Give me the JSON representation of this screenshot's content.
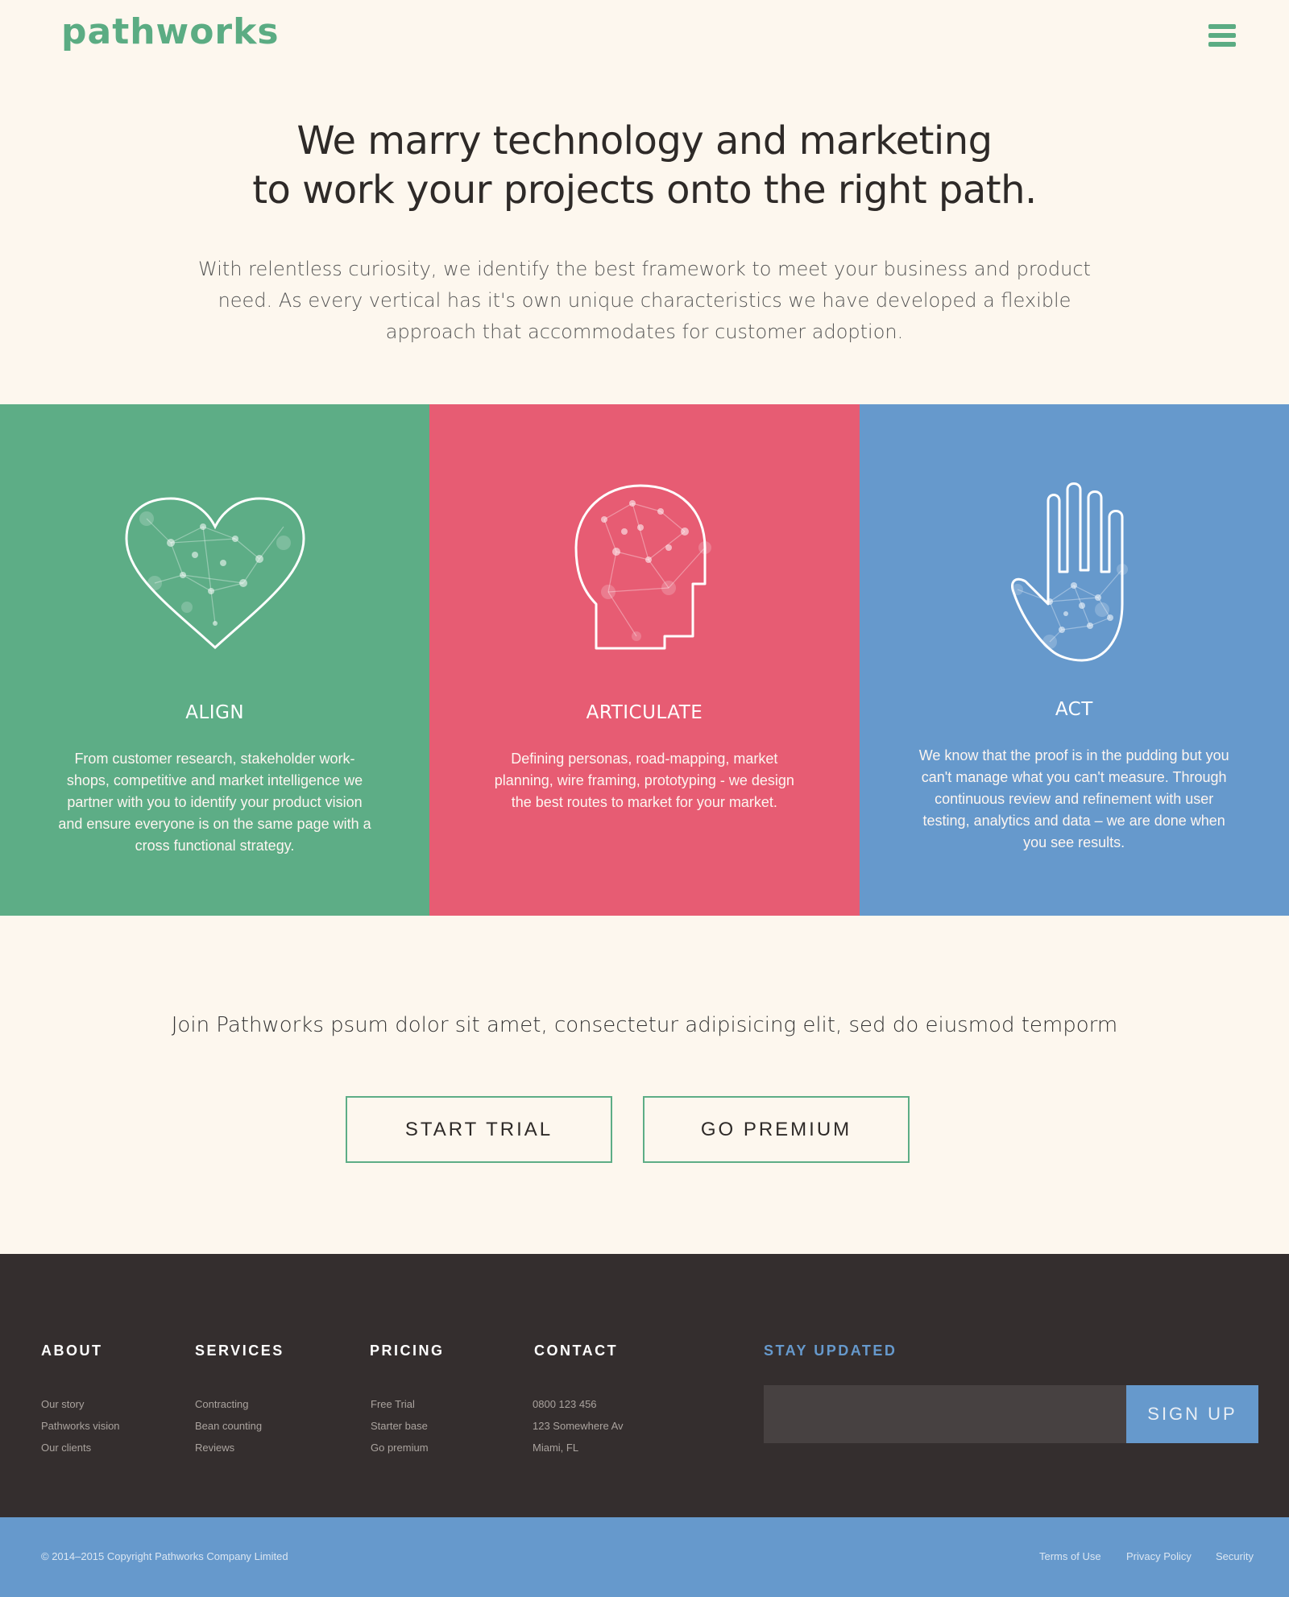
{
  "header": {
    "logo": "pathworks",
    "menu_icon": "hamburger-menu-icon"
  },
  "hero": {
    "title_line1": "We marry technology and marketing",
    "title_line2": "to work your projects onto the right path.",
    "subtitle": "With relentless curiosity, we identify the best framework to meet your business  and product need. As every vertical has it's own unique characteristics we have developed a flexible approach that accommodates for customer adoption."
  },
  "columns": [
    {
      "title": "ALIGN",
      "icon": "heart-network-icon",
      "color": "#5dad86",
      "text": "From customer research, stakeholder work-shops, competitive and market intelligence we partner with you to identify your product vision and ensure everyone is on the same page with a cross functional strategy."
    },
    {
      "title": "ARTICULATE",
      "icon": "head-network-icon",
      "color": "#e75c73",
      "text": "Defining personas, road-mapping, market planning, wire framing, prototyping - we design the best routes to market for your market."
    },
    {
      "title": "ACT",
      "icon": "hand-network-icon",
      "color": "#6699cc",
      "text": "We know that the proof is in the pudding but you can't manage what you can't measure.  Through continuous review and refinement with user testing, analytics and data – we are done when you see results."
    }
  ],
  "cta": {
    "text": "Join Pathworks psum dolor sit amet, consectetur adipisicing elit, sed do eiusmod temporm",
    "start_trial": "START TRIAL",
    "go_premium": "GO PREMIUM"
  },
  "footer": {
    "about": {
      "heading": "ABOUT",
      "links": [
        "Our story",
        "Pathworks vision",
        "Our clients"
      ]
    },
    "services": {
      "heading": "SERVICES",
      "links": [
        "Contracting",
        "Bean counting",
        "Reviews"
      ]
    },
    "pricing": {
      "heading": "PRICING",
      "links": [
        "Free Trial",
        "Starter base",
        "Go premium"
      ]
    },
    "contact": {
      "heading": "CONTACT",
      "lines": [
        "0800 123 456",
        "123 Somewhere Av",
        "Miami, FL"
      ]
    },
    "newsletter": {
      "heading": "STAY UPDATED",
      "input_value": "",
      "button": "SIGN UP"
    }
  },
  "bottom_bar": {
    "copyright": "© 2014–2015 Copyright Pathworks Company Limited",
    "terms": "Terms of Use",
    "privacy": "Privacy Policy",
    "security": "Security"
  },
  "colors": {
    "background": "#fdf7ee",
    "brand_green": "#5dad86",
    "brand_pink": "#e75c73",
    "brand_blue": "#6699cc",
    "footer_dark": "#342e2e"
  }
}
